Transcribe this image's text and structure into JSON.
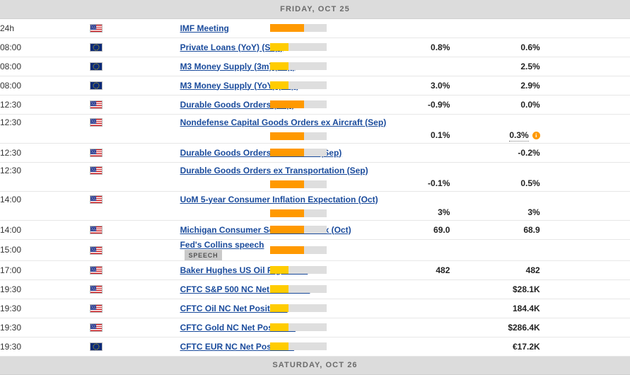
{
  "colors": {
    "link": "#1a4b9c",
    "vol_high": "#ff9900",
    "vol_low": "#ffcc00",
    "vol_track": "#dedede",
    "day_bar_bg": "#dcdcdc",
    "day_bar_text": "#6b6b6b",
    "badge_bg": "#c9c9c9"
  },
  "day_headers": {
    "top": "FRIDAY, OCT 25",
    "bottom": "SATURDAY, OCT 26"
  },
  "badges": {
    "speech": "SPEECH"
  },
  "icons": {
    "flag_us": "us-flag-icon",
    "flag_eu": "eu-flag-icon",
    "info": "info-icon",
    "info_glyph": "i"
  },
  "rows": [
    {
      "time": "24h",
      "flag": "us",
      "event": "IMF Meeting",
      "volatility": "high",
      "actual": "",
      "forecast": "",
      "badge": "",
      "tall": false,
      "info": false
    },
    {
      "time": "08:00",
      "flag": "eu",
      "event": "Private Loans (YoY) (Sep)",
      "volatility": "low",
      "actual": "0.8%",
      "forecast": "0.6%",
      "badge": "",
      "tall": false,
      "info": false
    },
    {
      "time": "08:00",
      "flag": "eu",
      "event": "M3 Money Supply (3m) (Sep)",
      "volatility": "low",
      "actual": "",
      "forecast": "2.5%",
      "badge": "",
      "tall": false,
      "info": false
    },
    {
      "time": "08:00",
      "flag": "eu",
      "event": "M3 Money Supply (YoY) (Sep)",
      "volatility": "low",
      "actual": "3.0%",
      "forecast": "2.9%",
      "badge": "",
      "tall": false,
      "info": false
    },
    {
      "time": "12:30",
      "flag": "us",
      "event": "Durable Goods Orders (Sep)",
      "volatility": "high",
      "actual": "-0.9%",
      "forecast": "0.0%",
      "badge": "",
      "tall": false,
      "info": false
    },
    {
      "time": "12:30",
      "flag": "us",
      "event": "Nondefense Capital Goods Orders ex Aircraft (Sep)",
      "volatility": "high",
      "actual": "0.1%",
      "forecast": "0.3%",
      "badge": "",
      "tall": true,
      "info": true
    },
    {
      "time": "12:30",
      "flag": "us",
      "event": "Durable Goods Orders ex Defense (Sep)",
      "volatility": "high",
      "actual": "",
      "forecast": "-0.2%",
      "badge": "",
      "tall": false,
      "info": false
    },
    {
      "time": "12:30",
      "flag": "us",
      "event": "Durable Goods Orders ex Transportation (Sep)",
      "volatility": "high",
      "actual": "-0.1%",
      "forecast": "0.5%",
      "badge": "",
      "tall": true,
      "info": false
    },
    {
      "time": "14:00",
      "flag": "us",
      "event": "UoM 5-year Consumer Inflation Expectation (Oct)",
      "volatility": "high",
      "actual": "3%",
      "forecast": "3%",
      "badge": "",
      "tall": true,
      "info": false
    },
    {
      "time": "14:00",
      "flag": "us",
      "event": "Michigan Consumer Sentiment Index (Oct)",
      "volatility": "high",
      "actual": "69.0",
      "forecast": "68.9",
      "badge": "",
      "tall": false,
      "info": false
    },
    {
      "time": "15:00",
      "flag": "us",
      "event": "Fed's Collins speech",
      "volatility": "high",
      "actual": "",
      "forecast": "",
      "badge": "SPEECH",
      "tall": false,
      "info": false
    },
    {
      "time": "17:00",
      "flag": "us",
      "event": "Baker Hughes US Oil Rig Count",
      "volatility": "low",
      "actual": "482",
      "forecast": "482",
      "badge": "",
      "tall": false,
      "info": false
    },
    {
      "time": "19:30",
      "flag": "us",
      "event": "CFTC S&P 500 NC Net Positions",
      "volatility": "low",
      "actual": "",
      "forecast": "$28.1K",
      "badge": "",
      "tall": false,
      "info": false
    },
    {
      "time": "19:30",
      "flag": "us",
      "event": "CFTC Oil NC Net Positions",
      "volatility": "low",
      "actual": "",
      "forecast": "184.4K",
      "badge": "",
      "tall": false,
      "info": false
    },
    {
      "time": "19:30",
      "flag": "us",
      "event": "CFTC Gold NC Net Positions",
      "volatility": "low",
      "actual": "",
      "forecast": "$286.4K",
      "badge": "",
      "tall": false,
      "info": false
    },
    {
      "time": "19:30",
      "flag": "eu",
      "event": "CFTC EUR NC Net Positions",
      "volatility": "low",
      "actual": "",
      "forecast": "€17.2K",
      "badge": "",
      "tall": false,
      "info": false
    }
  ]
}
